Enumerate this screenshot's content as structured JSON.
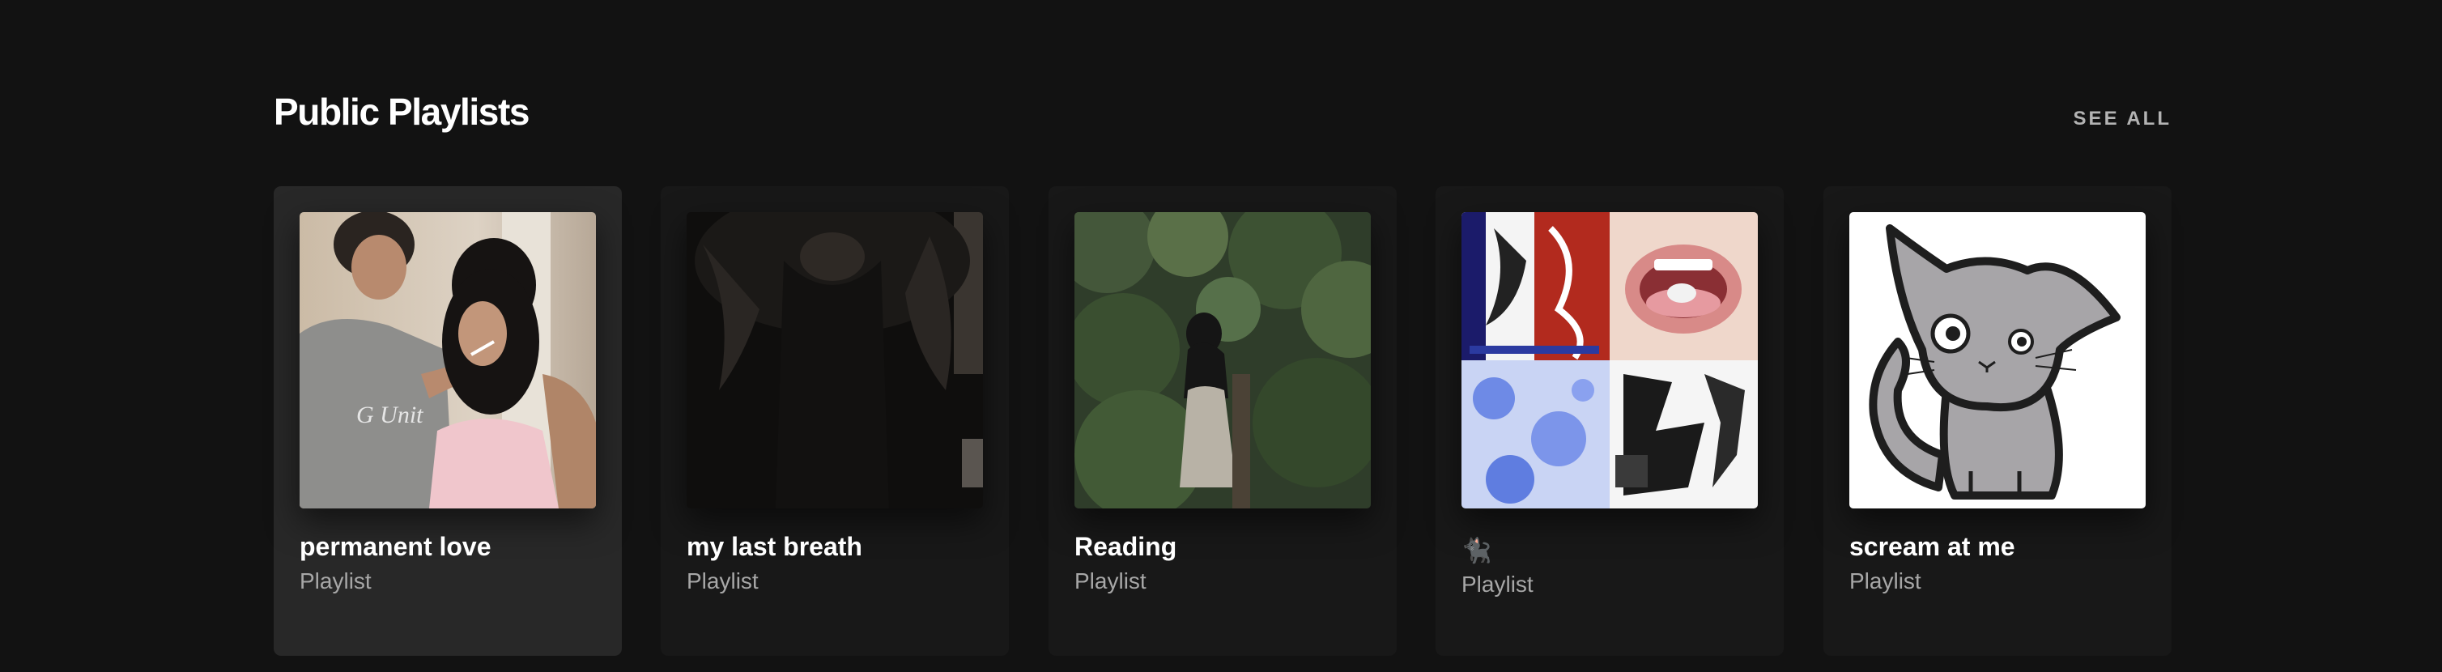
{
  "section": {
    "title": "Public Playlists",
    "see_all_label": "SEE ALL"
  },
  "playlists": [
    {
      "title": "permanent love",
      "subtitle": "Playlist",
      "cover": "photo-couple-smoking"
    },
    {
      "title": "my last breath",
      "subtitle": "Playlist",
      "cover": "photo-dark-hair-figure"
    },
    {
      "title": "Reading",
      "subtitle": "Playlist",
      "cover": "photo-forest-figure"
    },
    {
      "title": "🐈‍⬛",
      "subtitle": "Playlist",
      "cover": "collage-four-images"
    },
    {
      "title": "scream at me",
      "subtitle": "Playlist",
      "cover": "drawing-gray-cat"
    }
  ],
  "colors": {
    "background": "#121212",
    "card": "#181818",
    "card_hover": "#282828",
    "subtext": "#a7a7a7",
    "see_all": "#b3b3b3"
  }
}
